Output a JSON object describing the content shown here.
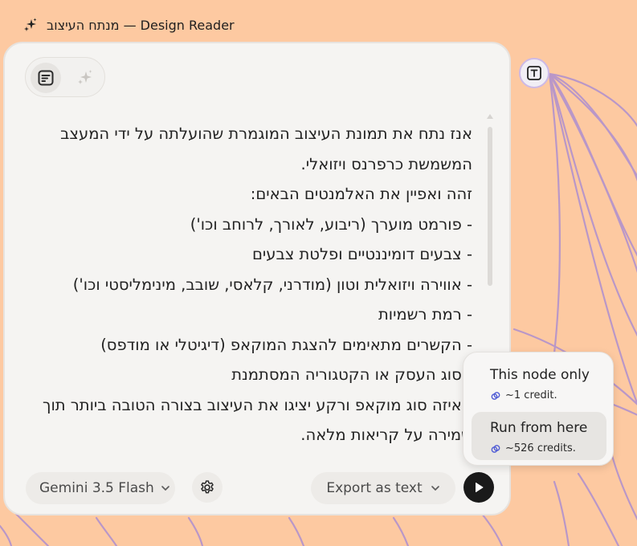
{
  "window": {
    "title": "מנתח העיצוב — Design Reader",
    "icon": "sparkle-icon"
  },
  "panel": {
    "mode_toggle": {
      "active": "text-prompt-icon",
      "inactive": "sparkle-icon"
    },
    "prompt_lines": [
      "אנז נתח את תמונת העיצוב המוגמרת שהועלתה על ידי המעצב המשמשת כרפרנס ויזואלי.",
      "זהה ואפיין את האלמנטים הבאים:",
      "- פורמט מוערך (ריבוע, לאורך, לרוחב וכו')",
      "- צבעים דומיננטיים ופלטת צבעים",
      "- אווירה ויזואלית וטון (מודרני, קלאסי, שובב, מינימליסטי וכו')",
      "- רמת רשמיות",
      "- הקשרים מתאימים להצגת המוקאפ (דיגיטלי או מודפס)",
      "- סוג העסק או הקטגוריה המסתמנת",
      "- איזה סוג מוקאפ ורקע יציגו את העיצוב בצורה הטובה ביותר תוך שמירה על קריאות מלאה."
    ],
    "model_label": "Gemini 3.5 Flash",
    "export_label": "Export as text",
    "settings_icon": "gear-icon",
    "run_icon": "play-icon"
  },
  "text_node": {
    "icon": "text-type-icon"
  },
  "run_menu": {
    "options": [
      {
        "label": "This node only",
        "credit": "~1 credit."
      },
      {
        "label": "Run from here",
        "credit": "~526 credits."
      }
    ]
  },
  "colors": {
    "background": "#FDC9A1",
    "panel": "#F5F4F2",
    "connector_lines": "#B997C8",
    "accent_blue": "#4F5BD5"
  }
}
